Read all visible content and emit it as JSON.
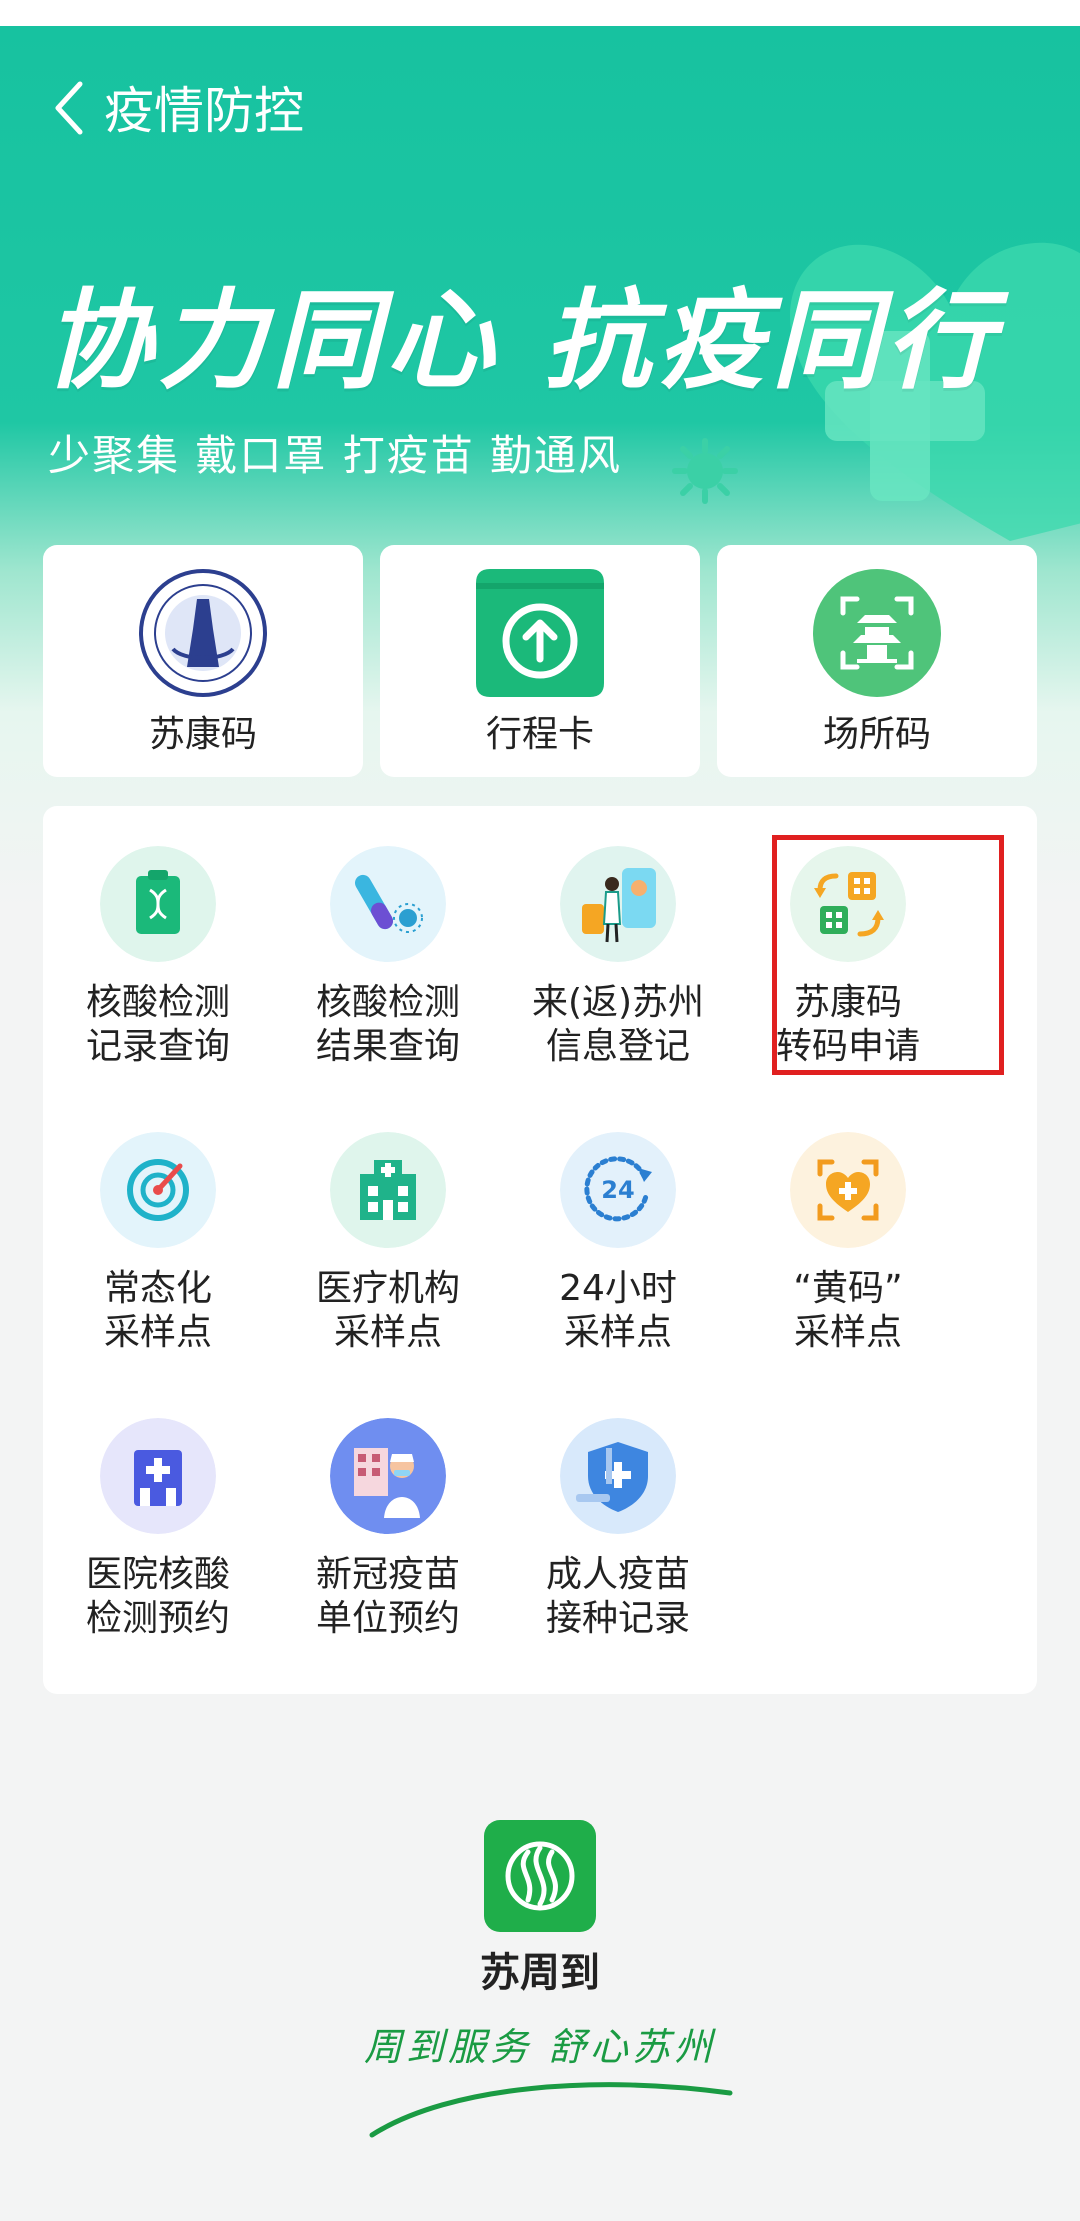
{
  "nav": {
    "title": "疫情防控"
  },
  "hero": {
    "slogan": "协力同心 抗疫同行",
    "subtitle": "少聚集 戴口罩 打疫苗 勤通风"
  },
  "quick_actions": [
    {
      "label": "苏康码",
      "icon": "health-commission-seal-icon"
    },
    {
      "label": "行程卡",
      "icon": "itinerary-card-upload-icon"
    },
    {
      "label": "场所码",
      "icon": "venue-scan-pavilion-icon"
    }
  ],
  "services": [
    {
      "label": "核酸检测\n记录查询",
      "icon": "dna-clipboard-icon"
    },
    {
      "label": "核酸检测\n结果查询",
      "icon": "test-tube-virus-icon"
    },
    {
      "label": "来(返)苏州\n信息登记",
      "icon": "traveler-luggage-icon"
    },
    {
      "label": "苏康码\n转码申请",
      "icon": "code-transfer-icon"
    },
    {
      "label": "常态化\n采样点",
      "icon": "target-location-icon"
    },
    {
      "label": "医疗机构\n采样点",
      "icon": "hospital-building-icon"
    },
    {
      "label": "24小时\n采样点",
      "icon": "24h-clock-icon"
    },
    {
      "label": "“黄码”\n采样点",
      "icon": "heart-scan-icon"
    },
    {
      "label": "医院核酸\n检测预约",
      "icon": "hospital-cross-icon"
    },
    {
      "label": "新冠疫苗\n单位预约",
      "icon": "nurse-vaccine-icon"
    },
    {
      "label": "成人疫苗\n接种记录",
      "icon": "vaccine-shield-icon"
    }
  ],
  "footer": {
    "brand_name": "苏周到",
    "tagline": "周到服务 舒心苏州",
    "logo_icon": "suzhoudao-logo-icon"
  },
  "colors": {
    "primary": "#1cc4a2",
    "highlight": "#e02020",
    "brand_green": "#1fae4a"
  }
}
